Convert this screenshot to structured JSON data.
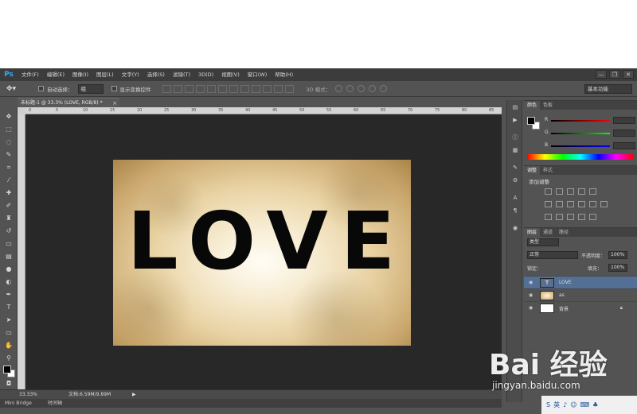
{
  "app": {
    "logo": "Ps",
    "menu": [
      "文件(F)",
      "编辑(E)",
      "图像(I)",
      "图层(L)",
      "文字(Y)",
      "选择(S)",
      "滤镜(T)",
      "3D(D)",
      "视图(V)",
      "窗口(W)",
      "帮助(H)"
    ],
    "window_buttons": [
      "—",
      "❐",
      "✕"
    ]
  },
  "options": {
    "auto_select_label": "自动选择：",
    "auto_select_value": "组",
    "show_transform_label": "显示变换控件",
    "mode_3d_label": "3D 模式：",
    "workspace": "基本功能"
  },
  "document": {
    "tab_title": "未标题-1 @ 33.3% (LOVE, RGB/8) *",
    "close": "×",
    "zoom": "33.33%",
    "doc_size": "文档:6.59M/9.89M",
    "canvas_text": "LOVE"
  },
  "ruler_ticks": [
    "0",
    "5",
    "10",
    "15",
    "20",
    "25",
    "30",
    "35",
    "40",
    "45",
    "50",
    "55",
    "60",
    "65",
    "70",
    "75",
    "80",
    "85",
    "90"
  ],
  "bottom_tabs": [
    "Mini Bridge",
    "时间轴"
  ],
  "panels": {
    "color": {
      "tabs": [
        "颜色",
        "色板"
      ],
      "channels": [
        "R",
        "G",
        "B"
      ]
    },
    "adjustments": {
      "tabs": [
        "调整",
        "样式"
      ],
      "title": "添加调整"
    },
    "layers": {
      "tabs": [
        "图层",
        "通道",
        "路径"
      ],
      "kind": "类型",
      "blend_mode": "正常",
      "opacity_label": "不透明度：",
      "opacity_value": "100%",
      "lock_label": "锁定：",
      "fill_label": "填充：",
      "fill_value": "100%",
      "items": [
        {
          "name": "LOVE",
          "thumb": "T"
        },
        {
          "name": "as",
          "thumb": ""
        },
        {
          "name": "背景",
          "thumb": ""
        }
      ]
    }
  },
  "watermark": {
    "logo": "Bai 经验",
    "url": "jingyan.baidu.com"
  },
  "taskbar": [
    "S",
    "英",
    "♪",
    "☺",
    "⌨",
    "♣"
  ]
}
